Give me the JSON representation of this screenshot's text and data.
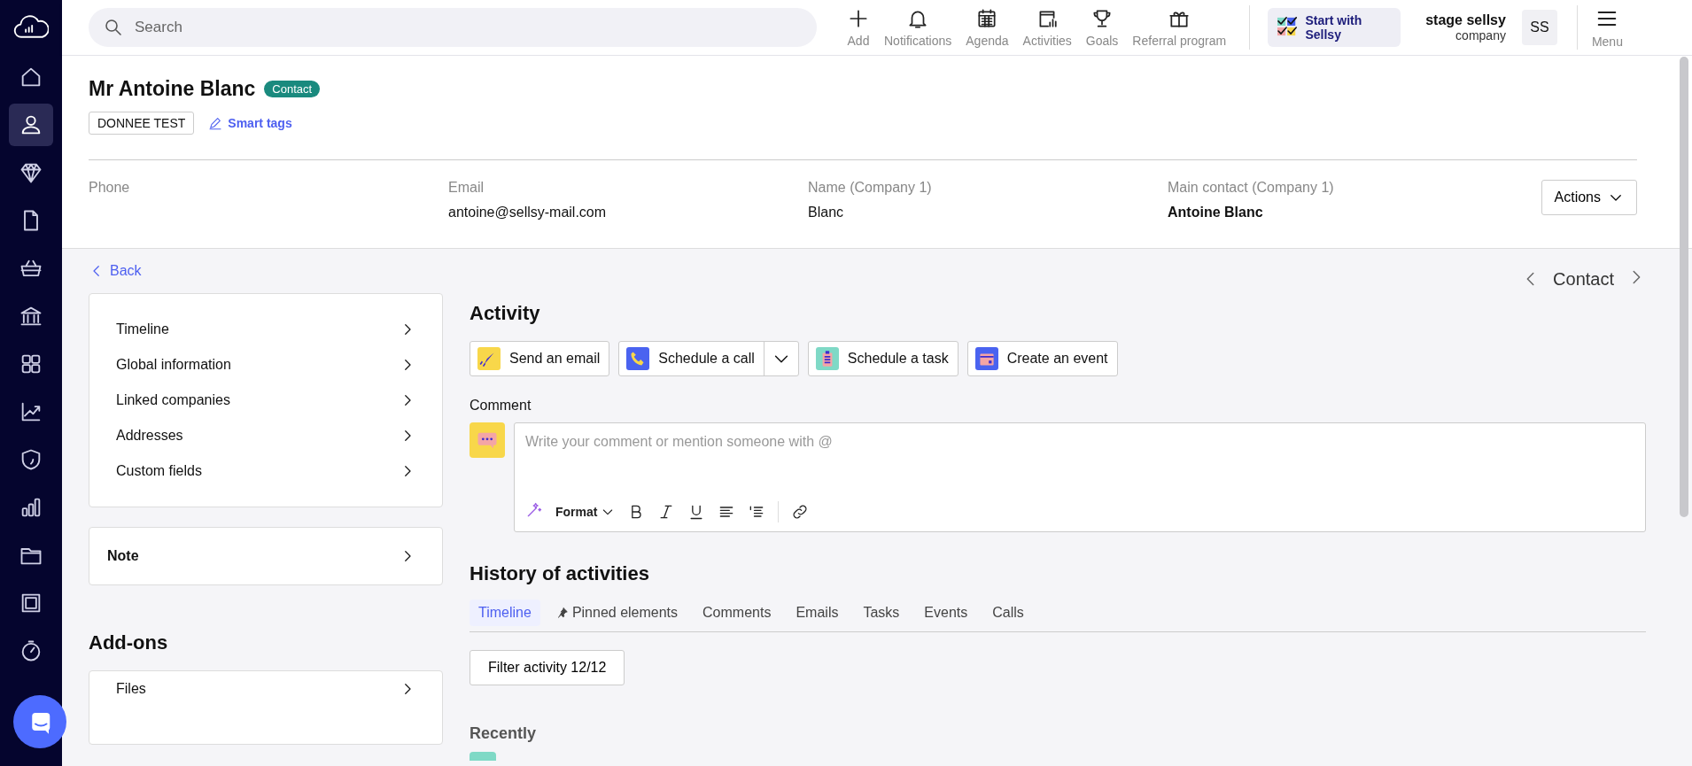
{
  "sidebar": {
    "items": [
      {
        "selected": false
      },
      {
        "selected": true
      },
      {
        "selected": false
      },
      {
        "selected": false
      },
      {
        "selected": false
      },
      {
        "selected": false
      },
      {
        "selected": false
      },
      {
        "selected": false
      },
      {
        "selected": false
      },
      {
        "selected": false
      },
      {
        "selected": false
      },
      {
        "selected": false
      },
      {
        "selected": false
      }
    ]
  },
  "topbar": {
    "search": {
      "placeholder": "Search"
    },
    "nav": [
      {
        "label": "Add",
        "kind": "add"
      },
      {
        "label": "Notifications",
        "kind": "bell"
      },
      {
        "label": "Agenda",
        "kind": "calendar"
      },
      {
        "label": "Activities",
        "kind": "activities"
      },
      {
        "label": "Goals",
        "kind": "trophy"
      },
      {
        "label": "Referral program",
        "kind": "gift"
      }
    ],
    "promo": "Start with Sellsy",
    "account": {
      "name": "stage sellsy",
      "type": "company",
      "initials": "SS"
    },
    "menu": "Menu"
  },
  "contact": {
    "name": "Mr Antoine Blanc",
    "badge": "Contact",
    "tags": [
      "DONNEE TEST"
    ],
    "smart_tags": "Smart tags",
    "fields": [
      {
        "label": "Phone"
      },
      {
        "label": "Email",
        "value": "antoine@sellsy-mail.com"
      },
      {
        "label": "Name (Company 1)",
        "value": "Blanc"
      },
      {
        "label": "Main contact (Company 1)",
        "value": "Antoine Blanc",
        "strong": true
      }
    ],
    "actions": "Actions"
  },
  "back": "Back",
  "record_nav": "Contact",
  "sections": [
    "Timeline",
    "Global information",
    "Linked companies",
    "Addresses",
    "Custom fields"
  ],
  "note": "Note",
  "addons": {
    "title": "Add-ons",
    "items": [
      "Files"
    ]
  },
  "activity": {
    "title": "Activity",
    "actions": [
      {
        "label": "Send an email",
        "kind": "email",
        "dropdown": false
      },
      {
        "label": "Schedule a call",
        "kind": "call",
        "dropdown": true
      },
      {
        "label": "Schedule a task",
        "kind": "task",
        "dropdown": false
      },
      {
        "label": "Create an event",
        "kind": "event",
        "dropdown": false
      }
    ],
    "comment": {
      "label": "Comment",
      "placeholder": "Write your comment or mention someone with @",
      "format": "Format"
    }
  },
  "history": {
    "title": "History of activities",
    "tabs": [
      {
        "label": "Timeline",
        "selected": true,
        "pinned": false
      },
      {
        "label": "Pinned elements",
        "selected": false,
        "pinned": true
      },
      {
        "label": "Comments",
        "selected": false,
        "pinned": false
      },
      {
        "label": "Emails",
        "selected": false,
        "pinned": false
      },
      {
        "label": "Tasks",
        "selected": false,
        "pinned": false
      },
      {
        "label": "Events",
        "selected": false,
        "pinned": false
      },
      {
        "label": "Calls",
        "selected": false,
        "pinned": false
      }
    ],
    "filter": "Filter activity 12/12",
    "recently": "Recently"
  }
}
